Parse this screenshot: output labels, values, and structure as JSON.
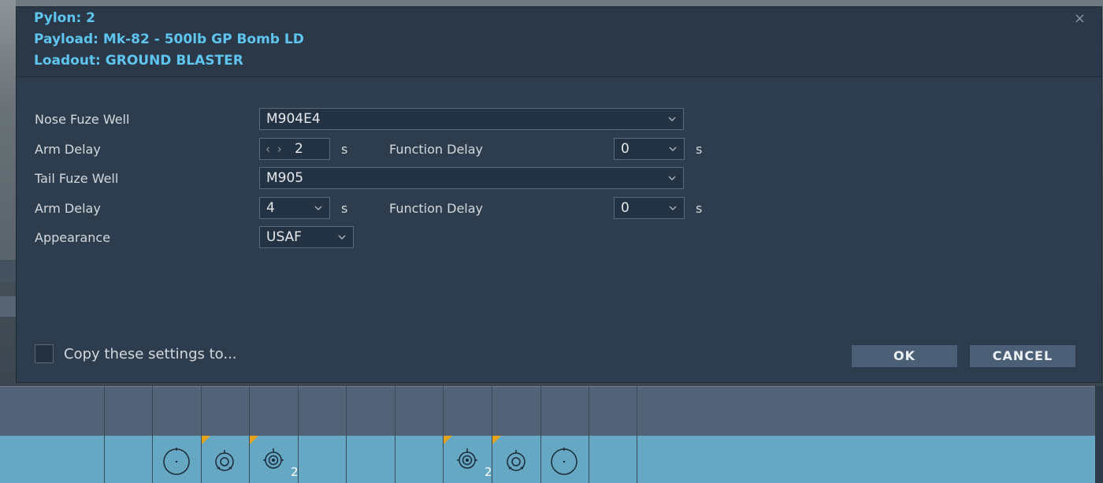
{
  "dialog": {
    "pylon": "Pylon: 2",
    "payload": "Payload: Mk-82 - 500lb GP Bomb LD",
    "loadout": "Loadout: GROUND BLASTER",
    "close": "×"
  },
  "form": {
    "nose_fuze_label": "Nose Fuze Well",
    "nose_fuze_value": "M904E4",
    "nose_arm_delay_label": "Arm Delay",
    "nose_arm_delay_arrows": "‹ ›",
    "nose_arm_delay_value": "2",
    "nose_arm_delay_unit": "s",
    "nose_function_delay_label": "Function Delay",
    "nose_function_delay_value": "0",
    "nose_function_delay_unit": "s",
    "tail_fuze_label": "Tail Fuze Well",
    "tail_fuze_value": "M905",
    "tail_arm_delay_label": "Arm Delay",
    "tail_arm_delay_value": "4",
    "tail_arm_delay_unit": "s",
    "tail_function_delay_label": "Function Delay",
    "tail_function_delay_value": "0",
    "tail_function_delay_unit": "s",
    "appearance_label": "Appearance",
    "appearance_value": "USAF"
  },
  "footer": {
    "copy_label": "Copy these settings to...",
    "ok": "OK",
    "cancel": "CANCEL"
  },
  "pylon_grid": {
    "counts": [
      "2",
      "2"
    ],
    "icons": [
      "pylon-weapon-icon",
      "fuze-weapon-icon",
      "cluster-weapon-icon"
    ]
  },
  "colors": {
    "accent": "#5fc4ee",
    "dialog_bg": "#2e3d4e",
    "grid_row": "#66a7c4",
    "flag": "#e8a21a"
  }
}
